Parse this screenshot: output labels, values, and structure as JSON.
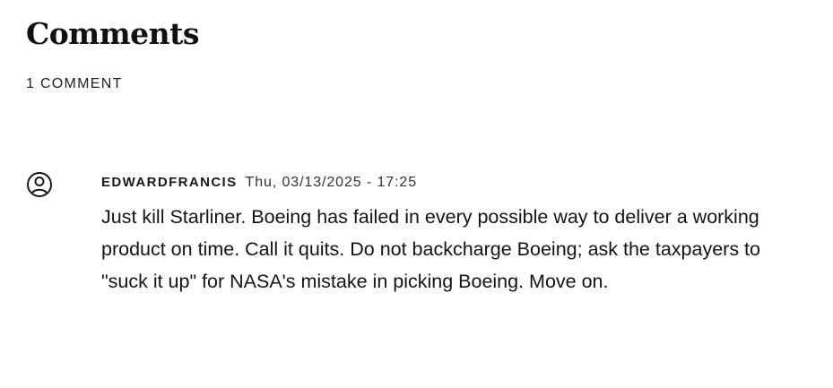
{
  "comments_section": {
    "title": "Comments",
    "count_label": "1 COMMENT"
  },
  "comments": [
    {
      "avatar_icon": "user-circle-icon",
      "author": "EDWARDFRANCIS",
      "date": "Thu, 03/13/2025 - 17:25",
      "text": "Just kill Starliner. Boeing has failed in every possible way to deliver a working product on time. Call it quits. Do not backcharge Boeing; ask the taxpayers to \"suck it up\" for NASA's mistake in picking Boeing. Move on."
    }
  ]
}
